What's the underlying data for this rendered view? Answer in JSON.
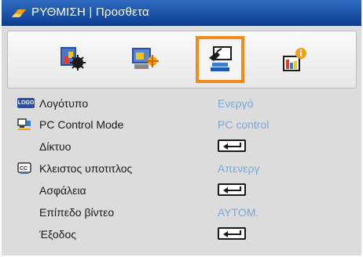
{
  "header": {
    "title": "ΡΥΘΜΙΣΗ | Προσθετα"
  },
  "tabs": [
    {
      "name": "image",
      "icon": "picture-settings-icon",
      "selected": false
    },
    {
      "name": "display",
      "icon": "display-settings-icon",
      "selected": false
    },
    {
      "name": "setup",
      "icon": "setup-settings-icon",
      "selected": true
    },
    {
      "name": "options",
      "icon": "options-info-icon",
      "selected": false
    }
  ],
  "menu": {
    "items": [
      {
        "label": "Λογότυπο",
        "value": "Ενεργό",
        "icon": "logo-badge-icon",
        "icon_text": "LOGO"
      },
      {
        "label": "PC Control Mode",
        "value": "PC control",
        "icon": "pc-control-icon"
      },
      {
        "label": "Δίκτυο",
        "value": "",
        "icon": ""
      },
      {
        "label": "Κλειστος υποτιτλος",
        "value": "Απενεργ",
        "icon": "closed-caption-icon"
      },
      {
        "label": "Ασφάλεια",
        "value": "",
        "icon": ""
      },
      {
        "label": "Επίπεδο βίντεο",
        "value": "ΑΥΤΟΜ.",
        "icon": ""
      },
      {
        "label": "Έξοδος",
        "value": "",
        "icon": ""
      }
    ]
  },
  "colors": {
    "accent": "#f38a1a",
    "title_bar": "#1a56b0",
    "value_text": "#79a8d8"
  }
}
